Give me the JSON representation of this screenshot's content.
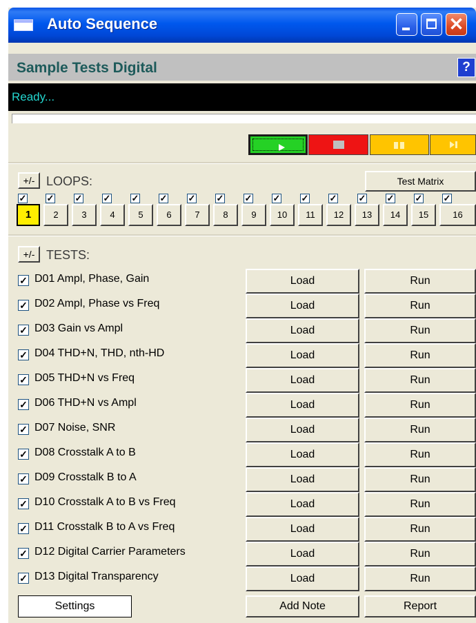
{
  "window": {
    "title": "Auto Sequence"
  },
  "header": {
    "title": "Sample Tests Digital",
    "help_label": "?"
  },
  "status": {
    "text": "Ready..."
  },
  "loops": {
    "toggle_label": "+/-",
    "label": "LOOPS:",
    "test_matrix_label": "Test Matrix",
    "numbers": [
      "1",
      "2",
      "3",
      "4",
      "5",
      "6",
      "7",
      "8",
      "9",
      "10",
      "11",
      "12",
      "13",
      "14",
      "15",
      "16"
    ],
    "active": "1"
  },
  "tests": {
    "toggle_label": "+/-",
    "label": "TESTS:",
    "load_label": "Load",
    "run_label": "Run",
    "items": [
      "D01 Ampl, Phase, Gain",
      "D02 Ampl, Phase vs Freq",
      "D03 Gain vs Ampl",
      "D04 THD+N, THD, nth-HD",
      "D05 THD+N vs Freq",
      "D06 THD+N vs Ampl",
      "D07 Noise, SNR",
      "D08 Crosstalk A to B",
      "D09 Crosstalk B to A",
      "D10 Crosstalk A to B vs Freq",
      "D11 Crosstalk B to A vs Freq",
      "D12 Digital Carrier Parameters",
      "D13 Digital Transparency"
    ]
  },
  "footer": {
    "settings_label": "Settings",
    "add_note_label": "Add Note",
    "report_label": "Report"
  },
  "colors": {
    "title_bar": "#0058ee",
    "play": "#25d125",
    "stop": "#ee1414",
    "pause": "#ffc400",
    "active_loop": "#ffee00",
    "status_text": "#24d6cf"
  },
  "icons": [
    "window-app-icon",
    "minimize-icon",
    "maximize-icon",
    "close-icon",
    "play-icon",
    "stop-icon",
    "pause-icon",
    "step-icon",
    "checkmark-icon"
  ]
}
